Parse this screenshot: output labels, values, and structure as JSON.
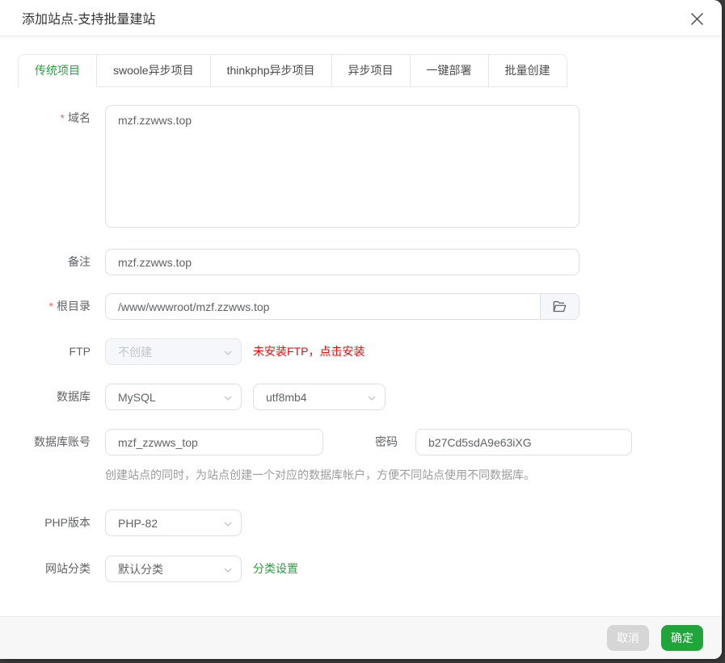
{
  "colors": {
    "green": "#20a53a",
    "red": "#ef0808",
    "footer_bg": "#f7f7f7"
  },
  "dialog": {
    "title": "添加站点-支持批量建站"
  },
  "tabs": [
    {
      "label": "传统项目",
      "active": true
    },
    {
      "label": "swoole异步项目",
      "active": false
    },
    {
      "label": "thinkphp异步项目",
      "active": false
    },
    {
      "label": "异步项目",
      "active": false
    },
    {
      "label": "一键部署",
      "active": false
    },
    {
      "label": "批量创建",
      "active": false
    }
  ],
  "form": {
    "required_mark": "*",
    "domain": {
      "label": "域名",
      "value": "mzf.zzwws.top"
    },
    "note": {
      "label": "备注",
      "value": "mzf.zzwws.top"
    },
    "root": {
      "label": "根目录",
      "value": "/www/wwwroot/mzf.zzwws.top"
    },
    "ftp": {
      "label": "FTP",
      "selected": "不创建",
      "warning": "未安装FTP，点击安装"
    },
    "database": {
      "label": "数据库",
      "engine_selected": "MySQL",
      "charset_selected": "utf8mb4"
    },
    "db_account": {
      "label": "数据库账号",
      "username": "mzf_zzwws_top",
      "password_label": "密码",
      "password": "b27Cd5sdA9e63iXG"
    },
    "db_help": "创建站点的同时，为站点创建一个对应的数据库帐户，方便不同站点使用不同数据库。",
    "php": {
      "label": "PHP版本",
      "selected": "PHP-82"
    },
    "category": {
      "label": "网站分类",
      "selected": "默认分类",
      "link": "分类设置"
    }
  },
  "footer": {
    "cancel_label": "取消",
    "confirm_label": "确定"
  }
}
